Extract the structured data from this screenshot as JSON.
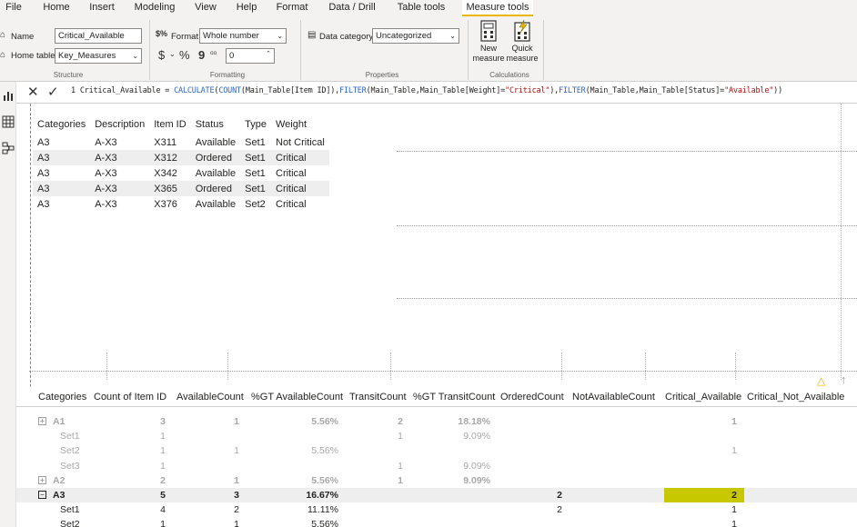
{
  "tabs": [
    "File",
    "Home",
    "Insert",
    "Modeling",
    "View",
    "Help",
    "Format",
    "Data / Drill",
    "Table tools",
    "Measure tools"
  ],
  "structure": {
    "name_label": "Name",
    "name_value": "Critical_Available",
    "home_table_label": "Home table",
    "home_table_value": "Key_Measures",
    "group_label": "Structure"
  },
  "formatting": {
    "format_label": "Format",
    "format_value": "Whole number",
    "currency_symbol": "$",
    "percent_symbol": "%",
    "comma_symbol": "9",
    "decimals_value": "0",
    "group_label": "Formatting"
  },
  "properties": {
    "data_category_label": "Data category",
    "data_category_value": "Uncategorized",
    "group_label": "Properties"
  },
  "calculations": {
    "new_measure": [
      "New",
      "measure"
    ],
    "quick_measure": [
      "Quick",
      "measure"
    ],
    "group_label": "Calculations"
  },
  "formula": {
    "line_no": "1",
    "measure_name": "Critical_Available",
    "eq": "=",
    "f_calculate": "CALCULATE",
    "f_count": "COUNT",
    "col_item": "(Main_Table[Item ID]),",
    "f_filter1": "FILTER",
    "filter1_args": "(Main_Table,Main_Table[Weight]=",
    "str_critical": "\"Critical\"",
    "close1": "),",
    "f_filter2": "FILTER",
    "filter2_args": "(Main_Table,Main_Table[Status]=",
    "str_available": "\"Available\"",
    "close2": "))"
  },
  "table1": {
    "headers": [
      "Categories",
      "Description",
      "Item ID",
      "Status",
      "Type",
      "Weight"
    ],
    "rows": [
      [
        "A3",
        "A-X3",
        "X311",
        "Available",
        "Set1",
        "Not Critical"
      ],
      [
        "A3",
        "A-X3",
        "X312",
        "Ordered",
        "Set1",
        "Critical"
      ],
      [
        "A3",
        "A-X3",
        "X342",
        "Available",
        "Set1",
        "Critical"
      ],
      [
        "A3",
        "A-X3",
        "X365",
        "Ordered",
        "Set1",
        "Critical"
      ],
      [
        "A3",
        "A-X3",
        "X376",
        "Available",
        "Set2",
        "Critical"
      ]
    ]
  },
  "matrix": {
    "headers": [
      "Categories",
      "Count of Item ID",
      "AvailableCount",
      "%GT AvailableCount",
      "TransitCount",
      "%GT TransitCount",
      "OrderedCount",
      "NotAvailableCount",
      "Critical_Available",
      "Critical_Not_Available"
    ],
    "rows": [
      {
        "label": "A1",
        "level": 0,
        "style": "faded-bold",
        "vals": [
          "3",
          "1",
          "5.56%",
          "2",
          "18.18%",
          "",
          "",
          "1",
          ""
        ]
      },
      {
        "label": "Set1",
        "level": 1,
        "style": "faded",
        "vals": [
          "1",
          "",
          "",
          "1",
          "9.09%",
          "",
          "",
          "",
          ""
        ]
      },
      {
        "label": "Set2",
        "level": 1,
        "style": "faded",
        "vals": [
          "1",
          "1",
          "5.56%",
          "",
          "",
          "",
          "",
          "1",
          ""
        ]
      },
      {
        "label": "Set3",
        "level": 1,
        "style": "faded",
        "vals": [
          "1",
          "",
          "",
          "1",
          "9.09%",
          "",
          "",
          "",
          ""
        ]
      },
      {
        "label": "A2",
        "level": 0,
        "style": "faded-bold",
        "vals": [
          "2",
          "1",
          "5.56%",
          "1",
          "9.09%",
          "",
          "",
          "",
          ""
        ]
      },
      {
        "label": "A3",
        "level": 0,
        "style": "bold",
        "vals": [
          "5",
          "3",
          "16.67%",
          "",
          "",
          "2",
          "",
          "2",
          ""
        ]
      },
      {
        "label": "Set1",
        "level": 1,
        "style": "normal",
        "vals": [
          "4",
          "2",
          "11.11%",
          "",
          "",
          "2",
          "",
          "1",
          ""
        ]
      },
      {
        "label": "Set2",
        "level": 1,
        "style": "normal",
        "vals": [
          "1",
          "1",
          "5.56%",
          "",
          "",
          "",
          "",
          "1",
          ""
        ]
      }
    ],
    "expand_minus": "⊟",
    "expand_plus": "⊞"
  },
  "colors": {
    "highlight": "#c8c800",
    "accent_tab": "#e8b800",
    "formula_keyword": "#3165bb",
    "formula_string": "#a31515"
  }
}
